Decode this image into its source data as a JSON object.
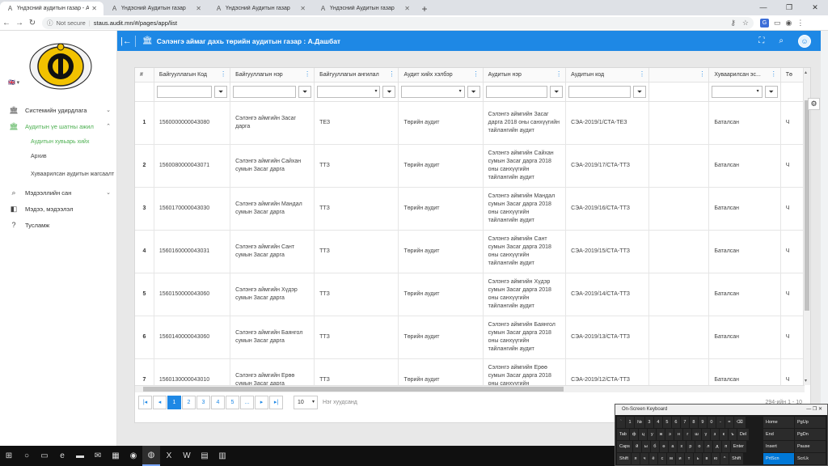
{
  "browser": {
    "tabs": [
      {
        "title": "Үндэсний аудитын газар - Аппл",
        "active": true
      },
      {
        "title": "Үндэсний Аудитын газар",
        "active": false
      },
      {
        "title": "Үндэсний Аудитын газар",
        "active": false
      },
      {
        "title": "Үндэсний Аудитын газар",
        "active": false
      }
    ],
    "not_secure": "Not secure",
    "url": "staus.audit.mn/#/pages/app/list",
    "window_controls": [
      "—",
      "❐",
      "✕"
    ]
  },
  "sidebar": {
    "lang": "🇬🇧 ▾",
    "items": [
      {
        "label": "Системийн удирдлага",
        "icon": "bank-icon",
        "glyph": "🏛",
        "chevron": "⌄"
      },
      {
        "label": "Аудитын үе шатны ажил",
        "icon": "bank-icon",
        "glyph": "🏛",
        "chevron": "⌃",
        "active": true
      },
      {
        "label": "Мэдээллийн сан",
        "icon": "database-search-icon",
        "glyph": "⌕",
        "chevron": "⌄"
      },
      {
        "label": "Мэдээ, мэдээлэл",
        "icon": "news-icon",
        "glyph": "◧"
      },
      {
        "label": "Тусламж",
        "icon": "help-icon",
        "glyph": "?"
      }
    ],
    "subitems": [
      {
        "label": "Аудитын хувьарь хийх",
        "active": true
      },
      {
        "label": "Архив"
      },
      {
        "label": "Хуваарилсан аудитын жагсаалт"
      }
    ]
  },
  "header": {
    "title": "Сэлэнгэ аймаг дахь төрийн аудитын газар : А.Дашбат",
    "color": "#1e88e5"
  },
  "table": {
    "columns": [
      "#",
      "Байгууллагын Код",
      "Байгууллагын нэр",
      "Байгууллагын ангилал",
      "Аудит хийх хэлбэр",
      "Аудитын нэр",
      "Аудитын код",
      "",
      "Хуваарилсан эс...",
      "Тө"
    ],
    "rows": [
      {
        "n": "1",
        "code": "1560000000043080",
        "name": "Сэлэнгэ аймгийн Засаг дарга",
        "category": "ТЕЗ",
        "form": "Төрийн аудит",
        "audit_name": "Сэлэнгэ аймгийн Засаг дарга 2018 оны санхүүгийн тайлангийн аудит",
        "audit_code": "СЭА-2019/1/СТА-ТЕЗ",
        "assigned": "Баталсан",
        "extra": "Ч"
      },
      {
        "n": "2",
        "code": "1560080000043071",
        "name": "Сэлэнгэ аймгийн Сайхан сумын Засаг дарга",
        "category": "ТТЗ",
        "form": "Төрийн аудит",
        "audit_name": "Сэлэнгэ аймгийн Сайхан сумын Засаг дарга 2018 оны санхүүгийн тайлангийн аудит",
        "audit_code": "СЭА-2019/17/СТА-ТТЗ",
        "assigned": "Баталсан",
        "extra": "Ч"
      },
      {
        "n": "3",
        "code": "1560170000043030",
        "name": "Сэлэнгэ аймгийн Мандал сумын Засаг дарга",
        "category": "ТТЗ",
        "form": "Төрийн аудит",
        "audit_name": "Сэлэнгэ аймгийн Мандал сумын Засаг дарга 2018 оны санхүүгийн тайлангийн аудит",
        "audit_code": "СЭА-2019/16/СТА-ТТЗ",
        "assigned": "Баталсан",
        "extra": "Ч"
      },
      {
        "n": "4",
        "code": "1560160000043031",
        "name": "Сэлэнгэ аймгийн Сант сумын Засаг дарга",
        "category": "ТТЗ",
        "form": "Төрийн аудит",
        "audit_name": "Сэлэнгэ аймгийн Сант сумын Засаг дарга 2018 оны санхүүгийн тайлангийн аудит",
        "audit_code": "СЭА-2019/15/СТА-ТТЗ",
        "assigned": "Баталсан",
        "extra": "Ч"
      },
      {
        "n": "5",
        "code": "1560150000043060",
        "name": "Сэлэнгэ аймгийн Хүдэр сумын Засаг дарга",
        "category": "ТТЗ",
        "form": "Төрийн аудит",
        "audit_name": "Сэлэнгэ аймгийн Хүдэр сумын Засаг дарга 2018 оны санхүүгийн тайлангийн аудит",
        "audit_code": "СЭА-2019/14/СТА-ТТЗ",
        "assigned": "Баталсан",
        "extra": "Ч"
      },
      {
        "n": "6",
        "code": "1560140000043060",
        "name": "Сэлэнгэ аймгийн Баянгол сумын Засаг дарга",
        "category": "ТТЗ",
        "form": "Төрийн аудит",
        "audit_name": "Сэлэнгэ аймгийн Баянгол сумын Засаг дарга 2018 оны санхүүгийн тайлангийн аудит",
        "audit_code": "СЭА-2019/13/СТА-ТТЗ",
        "assigned": "Баталсан",
        "extra": "Ч"
      },
      {
        "n": "7",
        "code": "1560130000043010",
        "name": "Сэлэнгэ аймгийн Ерөө сумын Засаг дарга",
        "category": "ТТЗ",
        "form": "Төрийн аудит",
        "audit_name": "Сэлэнгэ аймгийн Ерөө сумын Засаг дарга 2018 оны санхүүгийн тайлангийн аудит",
        "audit_code": "СЭА-2019/12/СТА-ТТЗ",
        "assigned": "Баталсан",
        "extra": "Ч"
      }
    ]
  },
  "pager": {
    "first": "|◂",
    "prev": "◂",
    "pages": [
      "1",
      "2",
      "3",
      "4",
      "5",
      "..."
    ],
    "next": "▸",
    "last": "▸|",
    "page_size": "10",
    "page_size_label": "Нэг хуудсанд",
    "info": "294-ийн 1 - 10"
  },
  "osk": {
    "title": "On-Screen Keyboard",
    "rows": [
      [
        "`",
        "1",
        "№",
        "3",
        "4",
        "5",
        "6",
        "7",
        "8",
        "9",
        "0",
        "-",
        "=",
        "⌫"
      ],
      [
        "Tab",
        "ф",
        "ц",
        "у",
        "ж",
        "э",
        "н",
        "г",
        "ш",
        "ү",
        "з",
        "к",
        "ъ",
        "Del"
      ],
      [
        "Caps",
        "й",
        "ы",
        "б",
        "ө",
        "а",
        "х",
        "р",
        "о",
        "л",
        "д",
        "п",
        "Enter"
      ],
      [
        "Shift",
        "я",
        "ч",
        "ё",
        "с",
        "м",
        "и",
        "т",
        "ь",
        "в",
        "ю",
        "^",
        "Shift"
      ]
    ],
    "side": [
      [
        "Home",
        "PgUp"
      ],
      [
        "End",
        "PgDn"
      ],
      [
        "Insert",
        "Pause"
      ],
      [
        "PrtScn",
        "ScrLk"
      ]
    ]
  },
  "taskbar": {
    "icons": [
      {
        "name": "start-icon",
        "glyph": "⊞"
      },
      {
        "name": "search-icon",
        "glyph": "○"
      },
      {
        "name": "task-view-icon",
        "glyph": "▭"
      },
      {
        "name": "edge-icon",
        "glyph": "e"
      },
      {
        "name": "file-explorer-icon",
        "glyph": "▬"
      },
      {
        "name": "mail-icon",
        "glyph": "✉"
      },
      {
        "name": "store-icon",
        "glyph": "▦"
      },
      {
        "name": "firefox-icon",
        "glyph": "◉"
      },
      {
        "name": "chrome-icon",
        "glyph": "◍"
      },
      {
        "name": "excel-icon",
        "glyph": "X"
      },
      {
        "name": "word-icon",
        "glyph": "W"
      },
      {
        "name": "network-icon",
        "glyph": "▤"
      },
      {
        "name": "notepad-icon",
        "glyph": "▥"
      }
    ]
  }
}
